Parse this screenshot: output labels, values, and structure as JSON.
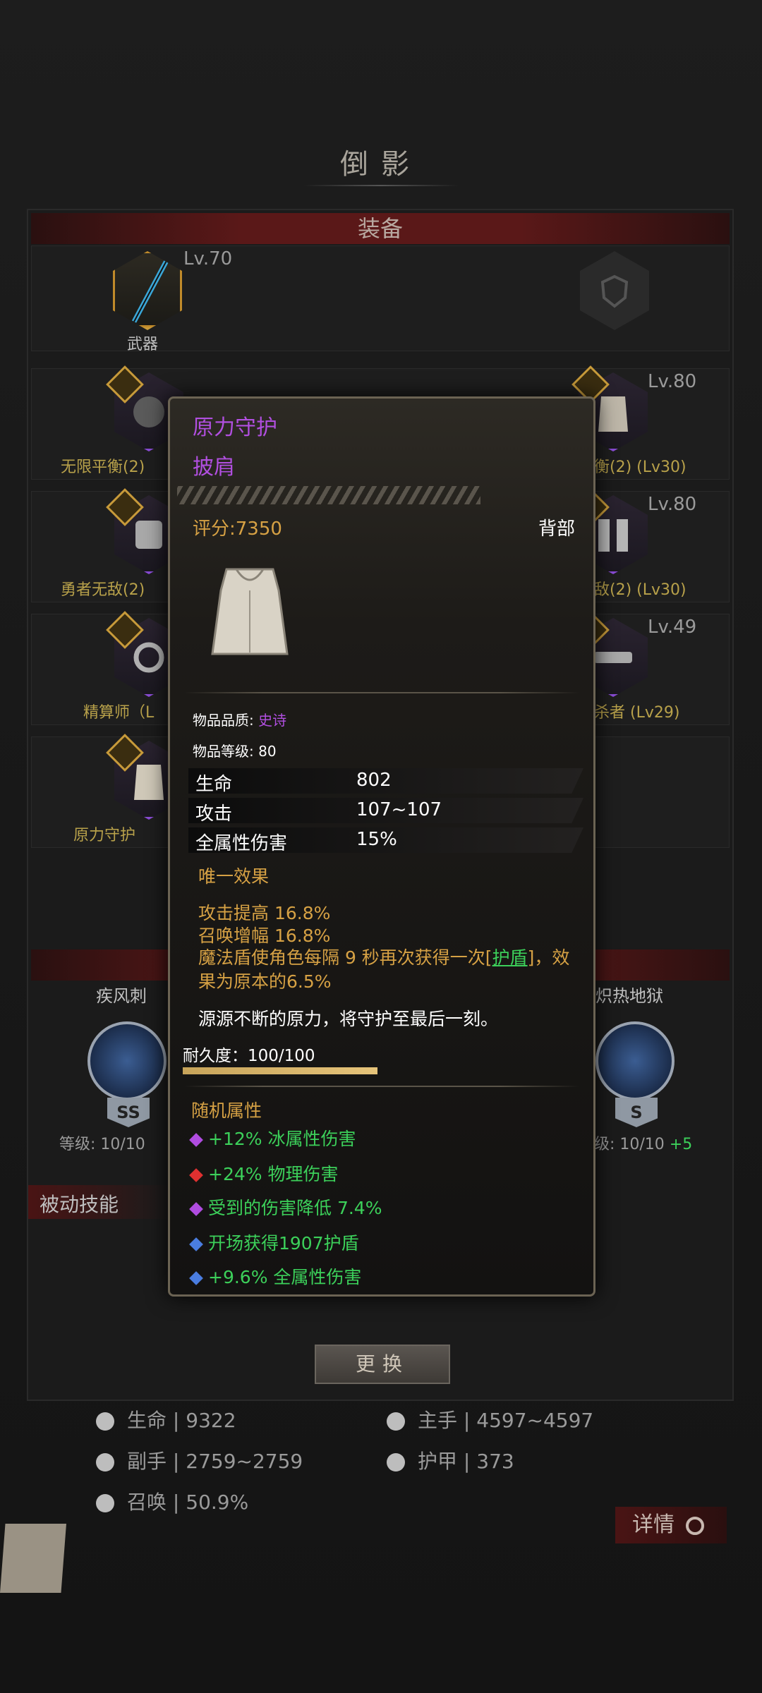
{
  "header": {
    "title": "倒影"
  },
  "equipment_section": {
    "title": "装备"
  },
  "equipment": {
    "weapon": {
      "level": "Lv.70",
      "label": "武器"
    },
    "left_items": [
      {
        "label": "无限平衡(2)"
      },
      {
        "label": "勇者无敌(2)"
      },
      {
        "label": "精算师（L"
      },
      {
        "label": "原力守护"
      }
    ],
    "right_items": [
      {
        "level": "Lv.80",
        "label": "衡(2)  (Lv30)"
      },
      {
        "level": "Lv.80",
        "label": "敌(2)  (Lv30)"
      },
      {
        "level": "Lv.49",
        "label": "杀者  (Lv29)"
      }
    ]
  },
  "skills": {
    "left": {
      "name": "疾风刺",
      "grade": "SS",
      "level": "等级: 10/10"
    },
    "right": {
      "name": "炽热地狱",
      "grade": "S",
      "level": "级: 10/10",
      "bonus": "+5"
    },
    "passive_title": "被动技能"
  },
  "popup": {
    "name": "原力守护",
    "type": "披肩",
    "score": "评分:7350",
    "slot": "背部",
    "quality_label": "物品品质:",
    "quality_value": "史诗",
    "level_label": "物品等级:",
    "level_value": "80",
    "attributes": [
      {
        "name": "生命",
        "value": "802"
      },
      {
        "name": "攻击",
        "value": "107~107"
      },
      {
        "name": "全属性伤害",
        "value": "15%"
      }
    ],
    "unique_title": "唯一效果",
    "unique_lines": [
      "攻击提高 16.8%",
      "召唤增幅 16.8%"
    ],
    "unique_line3_a": "魔法盾使角色每隔 9 秒再次获得一次[",
    "unique_line3_link": "护盾",
    "unique_line3_b": "]，效果为原本的6.5%",
    "flavor": "源源不断的原力，将守护至最后一刻。",
    "durability_label": "耐久度：100/100",
    "durability": 1.0,
    "random_title": "随机属性",
    "random_attrs": [
      {
        "text": "+12% 冰属性伤害",
        "gem": "#b04ce0"
      },
      {
        "text": "+24% 物理伤害",
        "gem": "#e03030"
      },
      {
        "text": "受到的伤害降低 7.4%",
        "gem": "#b04ce0"
      },
      {
        "text": "开场获得1907护盾",
        "gem": "#4a7de0"
      },
      {
        "text": "+9.6% 全属性伤害",
        "gem": "#4a7de0"
      }
    ]
  },
  "actions": {
    "replace_button": "更换",
    "detail_button": "详情"
  },
  "stats": {
    "hp": {
      "label": "生命",
      "value": "9322"
    },
    "main_hand": {
      "label": "主手",
      "value": "4597~4597"
    },
    "off_hand": {
      "label": "副手",
      "value": "2759~2759"
    },
    "armor": {
      "label": "护甲",
      "value": "373"
    },
    "summon": {
      "label": "召唤",
      "value": "50.9%"
    },
    "separator": "|"
  }
}
